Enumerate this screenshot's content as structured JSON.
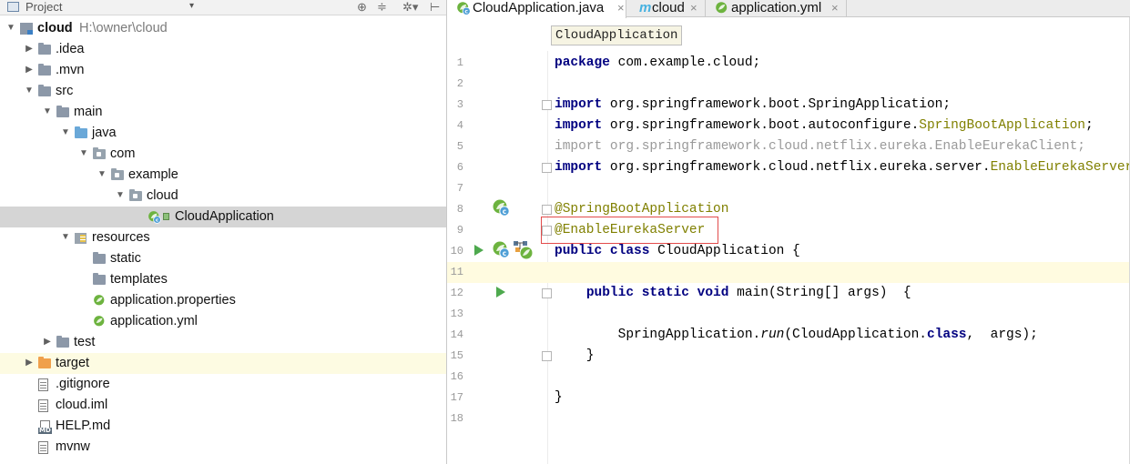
{
  "project_panel": {
    "title": "Project",
    "dropdown_glyph": "▾",
    "header_icons": [
      "target-icon",
      "collapse-icon",
      "settings-icon",
      "hide-icon"
    ],
    "tree": [
      {
        "label": "cloud",
        "extra": "H:\\owner\\cloud",
        "depth": 0,
        "icon": "module-icon",
        "expanded": true,
        "bold": true
      },
      {
        "label": ".idea",
        "depth": 1,
        "icon": "folder-icon",
        "expanded": false
      },
      {
        "label": ".mvn",
        "depth": 1,
        "icon": "folder-icon",
        "expanded": false
      },
      {
        "label": "src",
        "depth": 1,
        "icon": "folder-icon",
        "expanded": true
      },
      {
        "label": "main",
        "depth": 2,
        "icon": "folder-icon",
        "expanded": true
      },
      {
        "label": "java",
        "depth": 3,
        "icon": "source-folder-icon",
        "expanded": true
      },
      {
        "label": "com",
        "depth": 4,
        "icon": "package-icon",
        "expanded": true
      },
      {
        "label": "example",
        "depth": 5,
        "icon": "package-icon",
        "expanded": true
      },
      {
        "label": "cloud",
        "depth": 6,
        "icon": "package-icon",
        "expanded": true
      },
      {
        "label": "CloudApplication",
        "depth": 7,
        "icon": "spring-class-icon",
        "selected": true
      },
      {
        "label": "resources",
        "depth": 3,
        "icon": "resources-folder-icon",
        "expanded": true
      },
      {
        "label": "static",
        "depth": 4,
        "icon": "folder-icon"
      },
      {
        "label": "templates",
        "depth": 4,
        "icon": "folder-icon"
      },
      {
        "label": "application.properties",
        "depth": 4,
        "icon": "spring-config-icon"
      },
      {
        "label": "application.yml",
        "depth": 4,
        "icon": "spring-config-icon"
      },
      {
        "label": "test",
        "depth": 2,
        "icon": "folder-icon",
        "expanded": false
      },
      {
        "label": "target",
        "depth": 1,
        "icon": "excluded-folder-icon",
        "expanded": false,
        "highlight": true
      },
      {
        "label": ".gitignore",
        "depth": 1,
        "icon": "file-icon"
      },
      {
        "label": "cloud.iml",
        "depth": 1,
        "icon": "file-icon"
      },
      {
        "label": "HELP.md",
        "depth": 1,
        "icon": "markdown-icon",
        "icon_text": "MD"
      },
      {
        "label": "mvnw",
        "depth": 1,
        "icon": "file-icon"
      }
    ]
  },
  "editor": {
    "tabs": [
      {
        "label": "CloudApplication.java",
        "icon": "spring-class-icon",
        "active": true,
        "close": "×"
      },
      {
        "label": "cloud",
        "icon": "maven-icon",
        "icon_text": "m",
        "active": false,
        "close": "×"
      },
      {
        "label": "application.yml",
        "icon": "spring-config-icon",
        "active": false,
        "close": "×"
      }
    ],
    "breadcrumb": "CloudApplication",
    "lines": [
      {
        "n": "1",
        "segments": [
          [
            "kw",
            "package"
          ],
          [
            "t",
            " com.example.cloud;"
          ]
        ]
      },
      {
        "n": "2",
        "segments": []
      },
      {
        "n": "3",
        "segments": [
          [
            "kw",
            "import"
          ],
          [
            "t",
            " org.springframework.boot.SpringApplication;"
          ]
        ]
      },
      {
        "n": "4",
        "segments": [
          [
            "kw",
            "import"
          ],
          [
            "t",
            " org.springframework.boot.autoconfigure."
          ],
          [
            "ann",
            "SpringBootApplication"
          ],
          [
            "t",
            ";"
          ]
        ]
      },
      {
        "n": "5",
        "segments": [
          [
            "dim",
            "import org.springframework.cloud.netflix.eureka.EnableEurekaClient;"
          ]
        ]
      },
      {
        "n": "6",
        "segments": [
          [
            "kw",
            "import"
          ],
          [
            "t",
            " org.springframework.cloud.netflix.eureka.server."
          ],
          [
            "ann",
            "EnableEurekaServer"
          ],
          [
            "t",
            ";"
          ]
        ]
      },
      {
        "n": "7",
        "segments": []
      },
      {
        "n": "8",
        "segments": [
          [
            "ann",
            "@SpringBootApplication"
          ]
        ]
      },
      {
        "n": "9",
        "segments": [
          [
            "ann",
            "@EnableEurekaServer"
          ]
        ]
      },
      {
        "n": "10",
        "segments": [
          [
            "kw",
            "public class"
          ],
          [
            "t",
            " CloudApplication {"
          ]
        ]
      },
      {
        "n": "11",
        "segments": []
      },
      {
        "n": "12",
        "segments": [
          [
            "t",
            "    "
          ],
          [
            "kw",
            "public static void"
          ],
          [
            "t",
            " main(String[] args)  {"
          ]
        ]
      },
      {
        "n": "13",
        "segments": []
      },
      {
        "n": "14",
        "segments": [
          [
            "t",
            "        SpringApplication."
          ],
          [
            "it",
            "run"
          ],
          [
            "t",
            "(CloudApplication."
          ],
          [
            "kw",
            "class"
          ],
          [
            "t",
            ",  args);"
          ]
        ]
      },
      {
        "n": "15",
        "segments": [
          [
            "t",
            "    }"
          ]
        ]
      },
      {
        "n": "16",
        "segments": []
      },
      {
        "n": "17",
        "segments": [
          [
            "t",
            "}"
          ]
        ]
      },
      {
        "n": "18",
        "segments": []
      }
    ],
    "current_line": "11",
    "highlighted_annotation": "@EnableEurekaServer"
  },
  "colors": {
    "keyword": "#000080",
    "annotation": "#808000",
    "unused_import": "#9a9a9a",
    "selection": "#d5d5d5",
    "current_line": "#fffbe0",
    "highlight_box": "#e24b4b",
    "spring_green": "#6db33f"
  }
}
